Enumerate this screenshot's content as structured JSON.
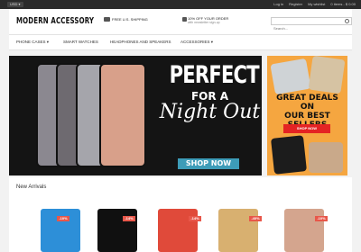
{
  "topbar": {
    "currency": "USD ▾",
    "links": [
      "Log in",
      "Register",
      "My wishlist",
      "0 items - $ 0.00"
    ]
  },
  "header": {
    "logo_text": "MODERN ACCESSORY",
    "shipping_text": "FREE U.S. SHIPPING",
    "promo_title": "10% OFF YOUR ORDER",
    "promo_sub": "with newsletter sign-up",
    "search_placeholder": "Search..."
  },
  "nav": {
    "items": [
      "PHONE CASES ▾",
      "SMART WATCHES",
      "HEADPHONES AND SPEAKERS",
      "ACCESSORIES ▾"
    ]
  },
  "hero": {
    "line1": "PERFECT",
    "line2": "FOR A",
    "line3": "Night Out",
    "cta": "SHOP NOW",
    "phone_colors": [
      "#8b8890",
      "#6e6a70",
      "#a5a5ab",
      "#d8a08a"
    ]
  },
  "side_banner": {
    "title_lines": [
      "GREAT DEALS ON",
      "OUR BEST SELLERS"
    ],
    "cta": "SHOP NOW",
    "bg_color": "#f5a640"
  },
  "new_arrivals": {
    "title": "New Arrivals",
    "products": [
      {
        "badge": "-10%",
        "color": "#2d8fd8"
      },
      {
        "badge": "-14%",
        "color": "#101010"
      },
      {
        "badge": "-14%",
        "color": "#e04a3a"
      },
      {
        "badge": "-40%",
        "color": "#d8b070"
      },
      {
        "badge": "-10%",
        "color": "#d4a58e"
      }
    ]
  }
}
